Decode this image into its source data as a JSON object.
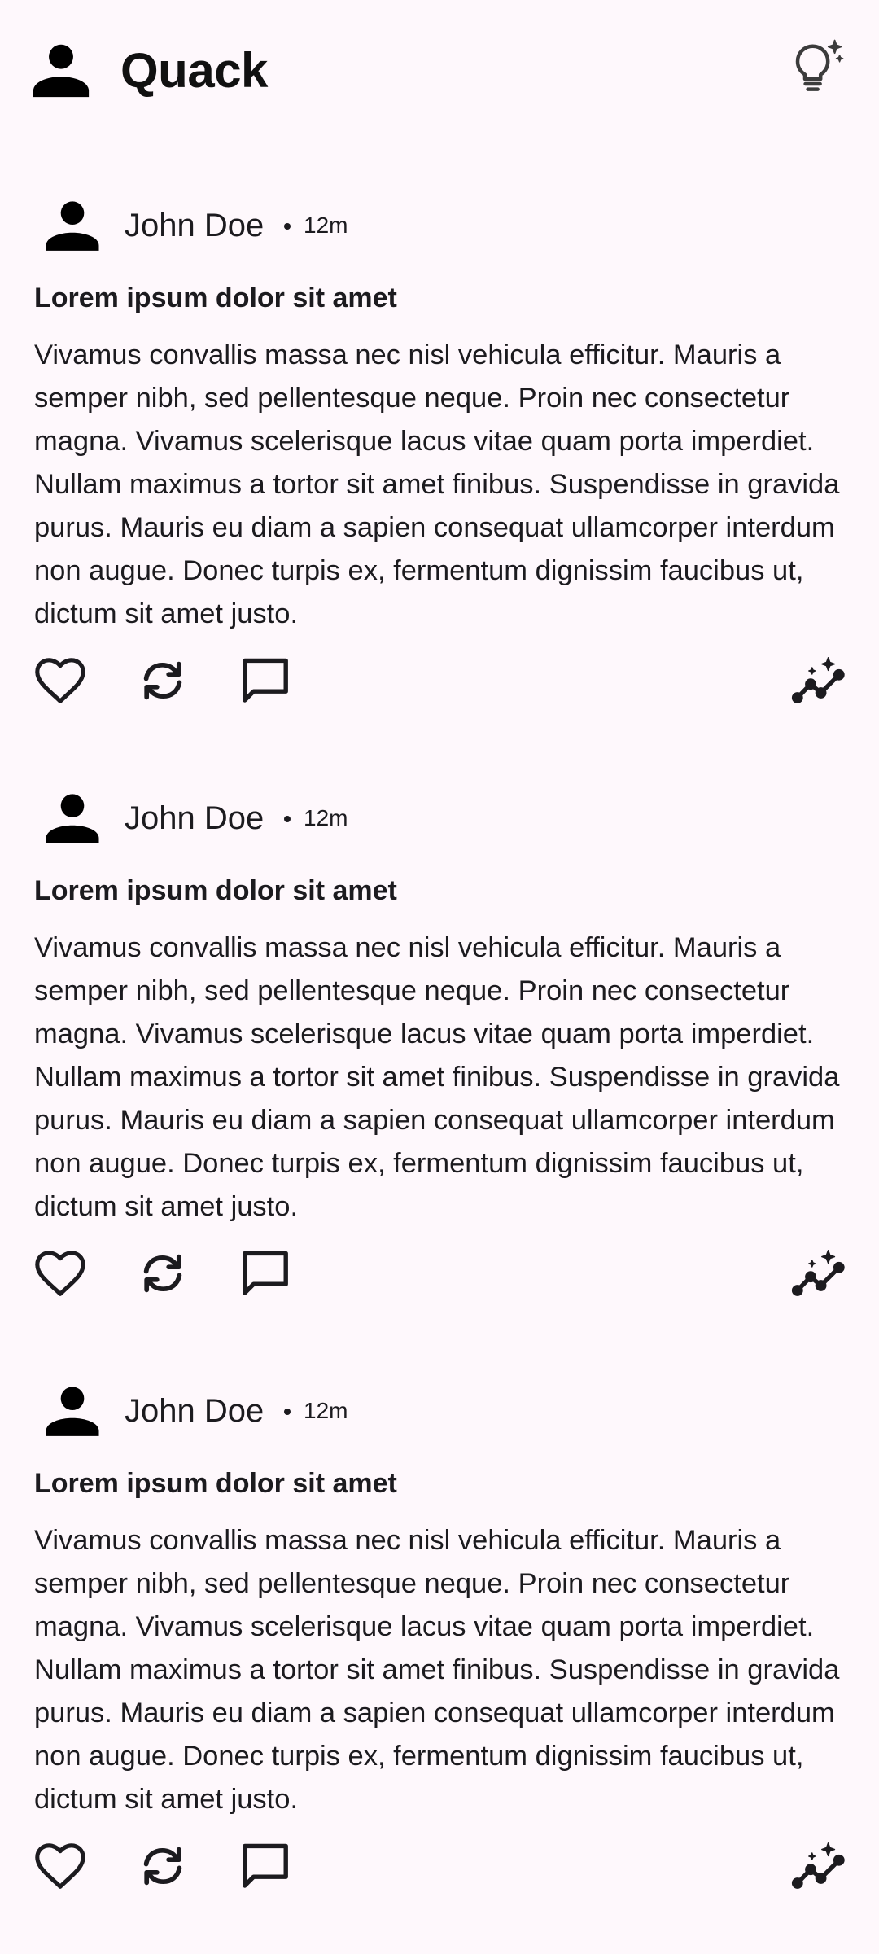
{
  "app": {
    "title": "Quack",
    "profile_icon": "person-icon",
    "theme_icon": "lightbulb-sparkle-icon"
  },
  "posts": [
    {
      "author": "John Doe",
      "time": "12m",
      "title": "Lorem ipsum dolor sit amet",
      "body": "Vivamus convallis massa nec nisl vehicula efficitur. Mauris a semper nibh, sed pellentesque neque. Proin nec consectetur magna. Vivamus scelerisque lacus vitae quam porta imperdiet. Nullam maximus a tortor sit amet finibus. Suspendisse in gravida purus. Mauris eu diam a sapien consequat ullamcorper interdum non augue. Donec turpis ex, fermentum dignissim faucibus ut, dictum sit amet justo."
    },
    {
      "author": "John Doe",
      "time": "12m",
      "title": "Lorem ipsum dolor sit amet",
      "body": "Vivamus convallis massa nec nisl vehicula efficitur. Mauris a semper nibh, sed pellentesque neque. Proin nec consectetur magna. Vivamus scelerisque lacus vitae quam porta imperdiet. Nullam maximus a tortor sit amet finibus. Suspendisse in gravida purus. Mauris eu diam a sapien consequat ullamcorper interdum non augue. Donec turpis ex, fermentum dignissim faucibus ut, dictum sit amet justo."
    },
    {
      "author": "John Doe",
      "time": "12m",
      "title": "Lorem ipsum dolor sit amet",
      "body": "Vivamus convallis massa nec nisl vehicula efficitur. Mauris a semper nibh, sed pellentesque neque. Proin nec consectetur magna. Vivamus scelerisque lacus vitae quam porta imperdiet. Nullam maximus a tortor sit amet finibus. Suspendisse in gravida purus. Mauris eu diam a sapien consequat ullamcorper interdum non augue. Donec turpis ex, fermentum dignissim faucibus ut, dictum sit amet justo."
    }
  ],
  "actions": {
    "like_icon": "heart-icon",
    "repost_icon": "repost-icon",
    "comment_icon": "comment-icon",
    "stats_icon": "insights-icon"
  },
  "colors": {
    "background": "#fef8fc",
    "text": "#1c1b1f"
  }
}
